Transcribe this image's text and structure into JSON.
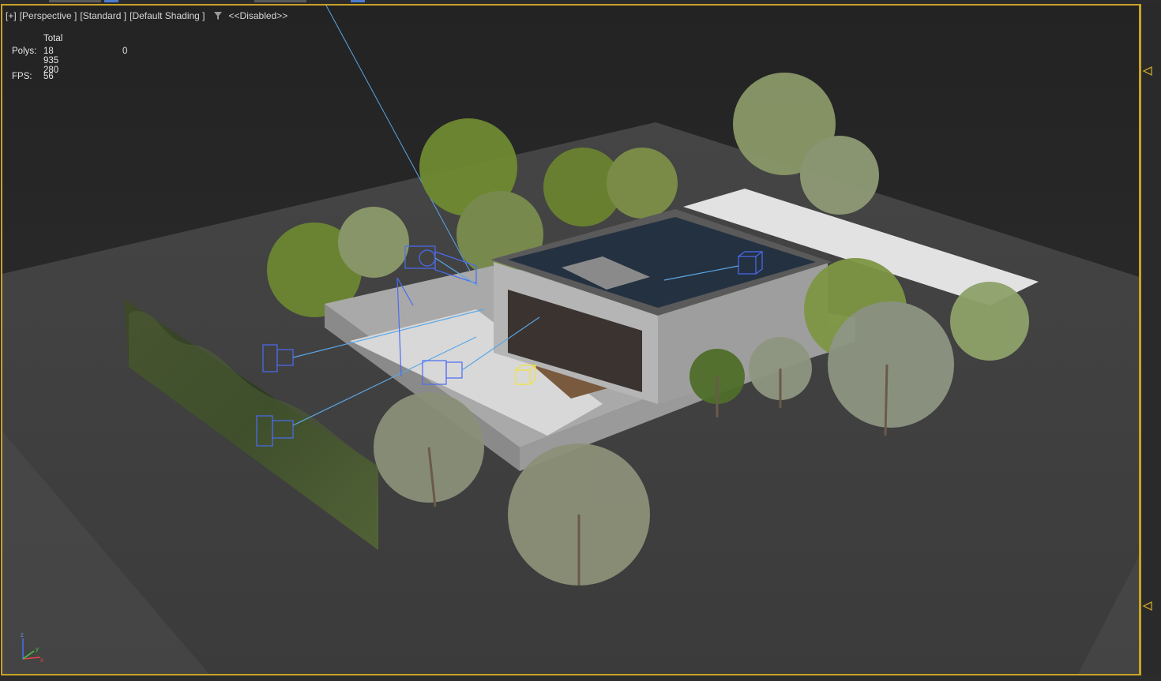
{
  "viewport": {
    "label_plus": "[+]",
    "label_view": "[Perspective ]",
    "label_mode": "[Standard ]",
    "label_shading": "[Default Shading ]",
    "label_filter": "<<Disabled>>"
  },
  "stats": {
    "total_header": "Total",
    "polys_label": "Polys:",
    "polys_value": "18 935 280",
    "polys_selected": "0",
    "fps_label": "FPS:",
    "fps_value": "56"
  },
  "axis": {
    "x": "x",
    "y": "y",
    "z": "z"
  },
  "colors": {
    "viewport_border": "#c9a227",
    "ground": "#3a3a3a",
    "camera_wire": "#4a6cf2",
    "selected_helper": "#f2e23a"
  }
}
